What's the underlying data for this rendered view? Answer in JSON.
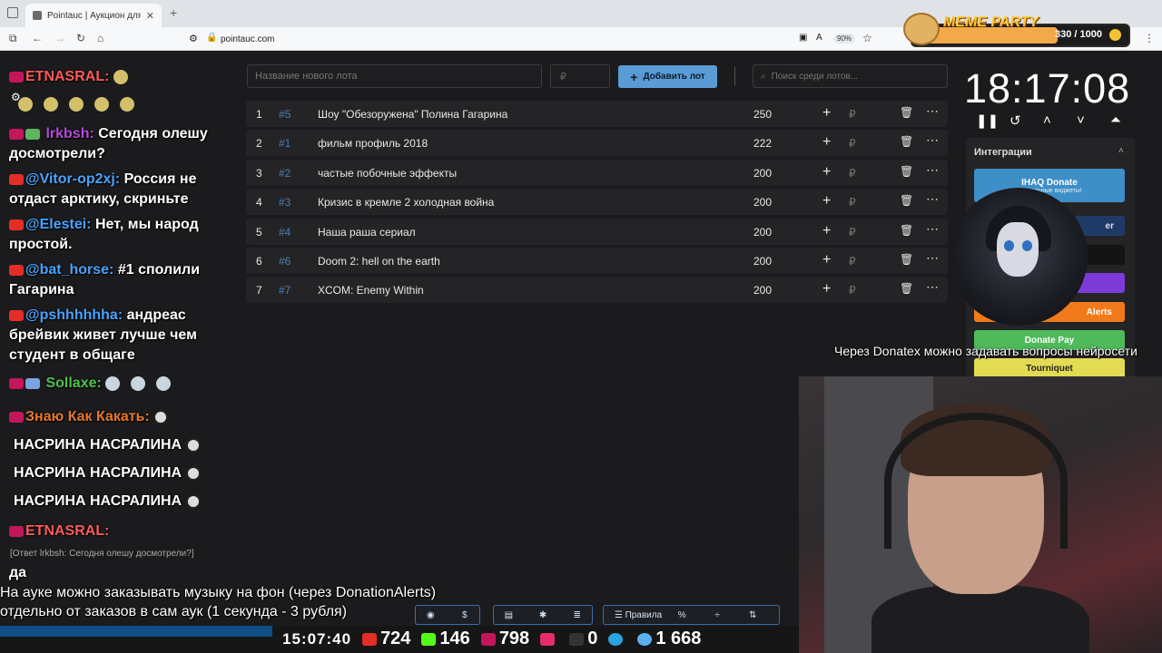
{
  "browser": {
    "tab_title": "Pointauc | Аукцион для стримеров",
    "url": "pointauc.com",
    "zoom": "90%"
  },
  "chat": {
    "messages": [
      {
        "user": "ЕТNASRAL:",
        "user_color": "#ff5a5a",
        "text": ""
      },
      {
        "user": "lrkbsh:",
        "user_color": "#b44bd8",
        "text": "Сегодня олешу досмотрели?"
      },
      {
        "user": "@Vitor-op2xj:",
        "user_color": "#4aa3ff",
        "text": "Россия не отдаст арктику, скриньте"
      },
      {
        "user": "@Elestei:",
        "user_color": "#4aa3ff",
        "text": "Нет, мы народ простой."
      },
      {
        "user": "@bat_horse:",
        "user_color": "#4aa3ff",
        "text": "#1 сполили Гагарина"
      },
      {
        "user": "@pshhhhhha:",
        "user_color": "#4aa3ff",
        "text": "андреас брейвик живет лучше чем студент в общаге"
      },
      {
        "user": "Sollaxe:",
        "user_color": "#4fc24f",
        "text": ""
      },
      {
        "user": "Знаю Как Какать:",
        "user_color": "#e8782a",
        "text": ""
      },
      {
        "user": "",
        "user_color": "#ffffff",
        "text": "НАСРИНА НАСРАЛИНА"
      },
      {
        "user": "",
        "user_color": "#ffffff",
        "text": "НАСРИНА НАСРАЛИНА"
      },
      {
        "user": "",
        "user_color": "#ffffff",
        "text": "НАСРИНА НАСРАЛИНА"
      },
      {
        "user": "ЕТNASRAL:",
        "user_color": "#ff5a5a",
        "text": ""
      }
    ],
    "reply_preview": "[Ответ lrkbsh: Сегодня олешу досмотрели?]",
    "reply_text": "да"
  },
  "auction": {
    "new_lot_placeholder": "Название нового лота",
    "price_placeholder": "₽",
    "add_label": "Добавить лот",
    "search_placeholder": "Поиск среди лотов...",
    "lots": [
      {
        "pos": "1",
        "id": "#5",
        "name": "Шоу \"Обезоружена\" Полина Гагарина",
        "amount": "250"
      },
      {
        "pos": "2",
        "id": "#1",
        "name": "фильм профиль 2018",
        "amount": "222"
      },
      {
        "pos": "3",
        "id": "#2",
        "name": "частые побочные эффекты",
        "amount": "200"
      },
      {
        "pos": "4",
        "id": "#3",
        "name": "Кризис в кремле 2 холодная война",
        "amount": "200"
      },
      {
        "pos": "5",
        "id": "#4",
        "name": "Наша раша сериал",
        "amount": "200"
      },
      {
        "pos": "6",
        "id": "#6",
        "name": "Doom 2: hell on the earth",
        "amount": "200"
      },
      {
        "pos": "7",
        "id": "#7",
        "name": "XCOM: Enemy Within",
        "amount": "200"
      }
    ],
    "rub_sign": "₽"
  },
  "timer": {
    "value": "18:17:08"
  },
  "integrations": {
    "title": "Интеграции",
    "ihaq": "IHAQ Donate",
    "ihaq_sub": "Уникальные виджеты!",
    "blue_label": "er",
    "orange_label": "Alerts",
    "green_label": "Donate Pay",
    "yellow_label": "Tourniquet"
  },
  "overlay": {
    "donatex": "Через Donatex можно задавать вопросы нейросети",
    "meme_title": "MEME PARTY",
    "meme_count": "330 / 1000",
    "caption1": "На ауке можно заказывать музыку на фон (через DonationAlerts)",
    "caption2": "отдельно от заказов в сам аук (1 секунда - 3 рубля)"
  },
  "dock": {
    "rules": "Правила"
  },
  "stats": {
    "time": "15:07:40",
    "youtube": "724",
    "kick": "146",
    "live": "798",
    "r": "0",
    "telegram_blank": "",
    "viewers": "1 668"
  },
  "colors": {
    "accent": "#5b9bd5",
    "row_bg": "#242426",
    "app_bg": "#1b1b1d"
  }
}
